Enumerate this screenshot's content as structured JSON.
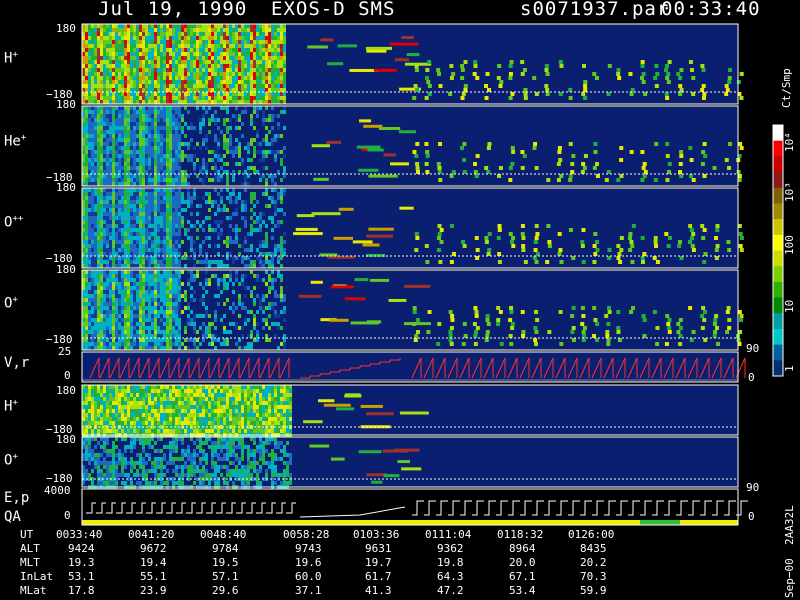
{
  "header": {
    "date": "Jul 19, 1990",
    "instrument": "EXOS-D SMS",
    "file": "s0071937.par",
    "time": "00:33:40"
  },
  "panels": [
    {
      "label_base": "H",
      "label_sup": "+",
      "ymax": "180",
      "ymin": "−180"
    },
    {
      "label_base": "He",
      "label_sup": "+",
      "ymax": "180",
      "ymin": "−180"
    },
    {
      "label_base": "O",
      "label_sup": "++",
      "ymax": "180",
      "ymin": "−180"
    },
    {
      "label_base": "O",
      "label_sup": "+",
      "ymax": "180",
      "ymin": "−180"
    },
    {
      "label_base": "V,r",
      "label_sup": "",
      "ymax": "25",
      "ymin": "0",
      "right": "90",
      "right2": "0"
    },
    {
      "label_base": "H",
      "label_sup": "+",
      "ymax": "180",
      "ymin": "−180"
    },
    {
      "label_base": "O",
      "label_sup": "+",
      "ymax": "180",
      "ymin": "−180",
      "right": "90"
    },
    {
      "label_base": "E,p",
      "label2": "QA",
      "label_sup": "",
      "ymax": "4000",
      "ymin": "0",
      "right2": "0"
    }
  ],
  "colorbar": {
    "units": "Ct/Smp",
    "labels": [
      "10⁴",
      "10³",
      "100",
      "10",
      "1"
    ],
    "colors": [
      "#ffffff",
      "#ff0000",
      "#cc0000",
      "#8a1a1a",
      "#806000",
      "#a08a00",
      "#c8c800",
      "#ffff00",
      "#c8e000",
      "#80d000",
      "#30b000",
      "#008800",
      "#00a0a0",
      "#00c8c8",
      "#0060a0",
      "#003070"
    ]
  },
  "footer_code": "Sep−00  2AA32L",
  "table": {
    "row_labels": [
      "UT",
      "ALT",
      "MLT",
      "InLat",
      "MLat"
    ],
    "columns": [
      [
        "0033:40",
        "9424",
        "19.3",
        "53.1",
        "17.8"
      ],
      [
        "0041:20",
        "9672",
        "19.4",
        "55.1",
        "23.9"
      ],
      [
        "0048:40",
        "9784",
        "19.5",
        "57.1",
        "29.6"
      ],
      [
        "0058:28",
        "9743",
        "19.6",
        "60.0",
        "37.1"
      ],
      [
        "0103:36",
        "9631",
        "19.7",
        "61.7",
        "41.3"
      ],
      [
        "0111:04",
        "9362",
        "19.8",
        "64.3",
        "47.2"
      ],
      [
        "0118:32",
        "8964",
        "20.0",
        "67.1",
        "53.4"
      ],
      [
        "0126:00",
        "8435",
        "20.2",
        "70.3",
        "59.9"
      ]
    ]
  },
  "chart_data": {
    "type": "heatmap",
    "title": "Jul 19, 1990   EXOS-D SMS",
    "ylim": [
      -180,
      180
    ],
    "x": [
      "0033:40",
      "0041:20",
      "0048:40",
      "0058:28",
      "0103:36",
      "0111:04",
      "0118:32",
      "0126:00"
    ],
    "colorbar_label": "Ct/Smp",
    "colorbar_ticks": [
      "1",
      "10",
      "100",
      "10³",
      "10⁴"
    ],
    "series": [
      {
        "name": "H+"
      },
      {
        "name": "He+"
      },
      {
        "name": "O++"
      },
      {
        "name": "O+"
      },
      {
        "name": "V,r",
        "ylim": [
          0,
          25
        ]
      },
      {
        "name": "H+"
      },
      {
        "name": "O+"
      },
      {
        "name": "E,p",
        "ylim": [
          0,
          4000
        ]
      }
    ]
  }
}
